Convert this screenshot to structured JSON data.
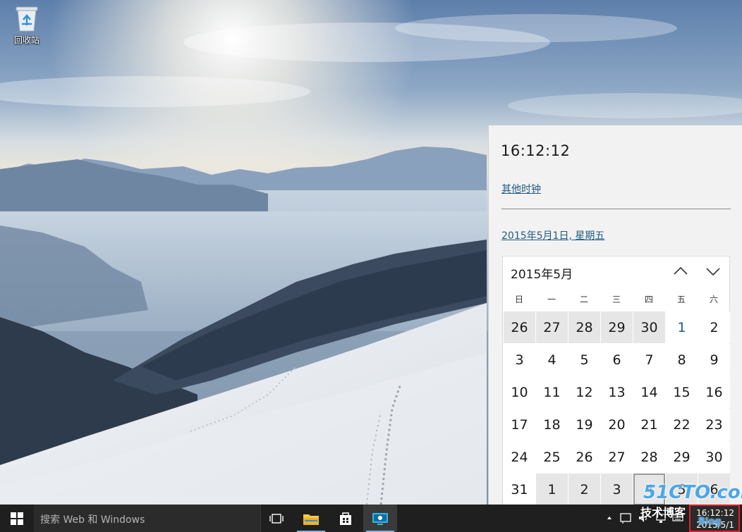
{
  "desktop": {
    "icons": [
      {
        "label": "回收站",
        "icon": "recycle-bin-icon"
      }
    ]
  },
  "flyout": {
    "time": "16:12:12",
    "other_clocks": "其他时钟",
    "date_link": "2015年5月1日, 星期五",
    "calendar": {
      "month_label": "2015年5月",
      "weekdays": [
        "日",
        "一",
        "二",
        "三",
        "四",
        "五",
        "六"
      ],
      "weeks": [
        [
          "26",
          "27",
          "28",
          "29",
          "30",
          "1",
          "2"
        ],
        [
          "3",
          "4",
          "5",
          "6",
          "7",
          "8",
          "9"
        ],
        [
          "10",
          "11",
          "12",
          "13",
          "14",
          "15",
          "16"
        ],
        [
          "17",
          "18",
          "19",
          "20",
          "21",
          "22",
          "23"
        ],
        [
          "24",
          "25",
          "26",
          "27",
          "28",
          "29",
          "30"
        ],
        [
          "31",
          "1",
          "2",
          "3",
          "4",
          "5",
          "6"
        ]
      ],
      "today": "1"
    }
  },
  "taskbar": {
    "search_placeholder": "搜索 Web 和 Windows",
    "clock_date": "2015/5/1",
    "pinned": [
      "task-view-icon",
      "file-explorer-icon",
      "store-icon",
      "remote-desktop-icon"
    ]
  },
  "watermark": {
    "line1": "51CTO.com",
    "line2": "技术博客",
    "line3": "Blog"
  },
  "colors": {
    "taskbar": "#1f1f1f",
    "flyout": "#f2f2f2",
    "link": "#1f5a83",
    "highlight": "#e3202a"
  }
}
